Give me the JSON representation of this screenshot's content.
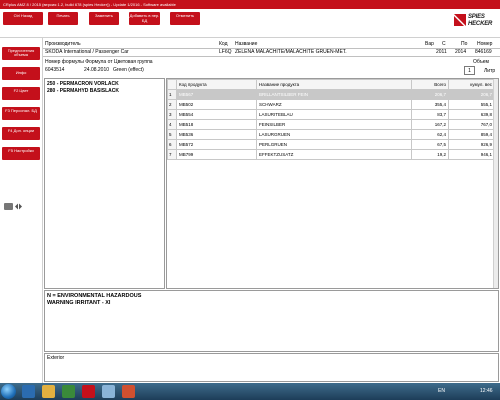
{
  "window": {
    "title": "CRplus AMZ 8 / 2015 (версия 1.2, build 678 (spies Hecker)) - Update 1/2016 - Software available"
  },
  "toolbar": {
    "buttons": [
      "Ctrl Назад",
      "Печать",
      "Заменить",
      "Добавить в пер. БД",
      "Отменить"
    ]
  },
  "brand": {
    "line1": "SPIES",
    "line2": "HECKER"
  },
  "sidebar": {
    "buttons": [
      "Предпочтения объема",
      "Инфо",
      "F2 Цвет",
      "F3 Персонал. БД",
      "F4 Доп. опции",
      "F5 Настройки"
    ]
  },
  "header": {
    "manufacturer_label": "Производитель",
    "manufacturer_value": "SKODA International / Passenger Car",
    "code_label": "Код",
    "code_value": "LF6Q",
    "name_label": "Название",
    "name_value": "ZELENA MALACHITE/MALACHITE GRUEN-MET.",
    "var_label": "Вар",
    "var_value": "",
    "c_label": "С",
    "c_value": "2011",
    "po_label": "По",
    "po_value": "2014",
    "num_label": "Номер",
    "num_value": "846169"
  },
  "formula": {
    "label": "Номер формулы Формула от Цветовая группа",
    "number": "6043514",
    "date": "24.08.2010",
    "group": "Green (effect)",
    "volume_label": "Объем",
    "volume_value": "1",
    "unit": "Литр"
  },
  "tree": {
    "nodes": [
      "250 - PERMACRON VORLACK",
      "280 - PERMAHYD BASISLACK"
    ]
  },
  "grid": {
    "columns": [
      "",
      "Код продукта",
      "Название продукта",
      "Всего",
      "кумул. вес"
    ],
    "rows": [
      {
        "n": "1",
        "code": "MB567",
        "name": "BRILLANTSILBER FEIN",
        "total": "206,7",
        "cum": "206,7",
        "selected": true
      },
      {
        "n": "2",
        "code": "MB502",
        "name": "SCHWARZ",
        "total": "355,4",
        "cum": "555,1",
        "selected": false
      },
      {
        "n": "3",
        "code": "MB554",
        "name": "LASURITEBLAU",
        "total": "83,7",
        "cum": "639,8",
        "selected": false
      },
      {
        "n": "4",
        "code": "MB518",
        "name": "FEINSILBER",
        "total": "167,2",
        "cum": "767,0",
        "selected": false
      },
      {
        "n": "5",
        "code": "MB536",
        "name": "LASURGRUEN",
        "total": "62,4",
        "cum": "859,4",
        "selected": false
      },
      {
        "n": "6",
        "code": "MB572",
        "name": "PERLGRUEN",
        "total": "67,5",
        "cum": "926,9",
        "selected": false
      },
      {
        "n": "7",
        "code": "MB799",
        "name": "EFFEKTZUSATZ",
        "total": "19,2",
        "cum": "946,1",
        "selected": false
      }
    ]
  },
  "hazard": {
    "line1": "N = ENVIRONMENTAL HAZARDOUS",
    "line2": "WARNING IRRITANT - XI"
  },
  "extra": {
    "label": "Exterior"
  },
  "taskbar": {
    "lang": "EN",
    "time": "12:46"
  },
  "colors": {
    "brand_red": "#c4101b",
    "selected_row": "#c8c8c8",
    "taskbar": "#2a4f6e"
  }
}
